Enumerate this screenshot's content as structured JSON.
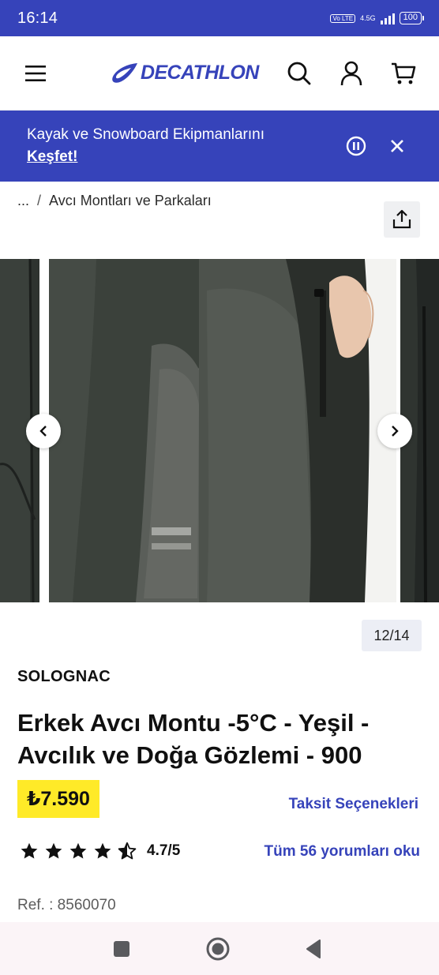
{
  "status_bar": {
    "time": "16:14",
    "volte": "Vo LTE",
    "network": "4.5G",
    "battery": "100"
  },
  "header": {
    "logo_text": "DECATHLON"
  },
  "banner": {
    "text": "Kayak ve Snowboard Ekipmanlarını",
    "link": "Keşfet!"
  },
  "breadcrumb": {
    "ellipsis": "...",
    "separator": "/",
    "current": "Avcı Montları ve Parkaları"
  },
  "gallery": {
    "counter": "12/14"
  },
  "product": {
    "brand": "SOLOGNAC",
    "title": "Erkek Avcı Montu -5°C - Yeşil - Avcılık ve Doğa Gözlemi - 900",
    "price": "₺7.590",
    "installments_link": "Taksit Seçenekleri",
    "rating_value": "4.7/5",
    "rating_stars": 4.5,
    "reviews_link": "Tüm 56 yorumları oku",
    "ref": "Ref. : 8560070"
  },
  "colors": {
    "brand_blue": "#3643ba",
    "price_yellow": "#ffea28"
  },
  "icons": {
    "menu": "hamburger-icon",
    "search": "search-icon",
    "account": "user-icon",
    "cart": "cart-icon",
    "pause": "pause-icon",
    "close": "close-icon",
    "share": "share-icon",
    "prev": "chevron-left-icon",
    "next": "chevron-right-icon"
  }
}
